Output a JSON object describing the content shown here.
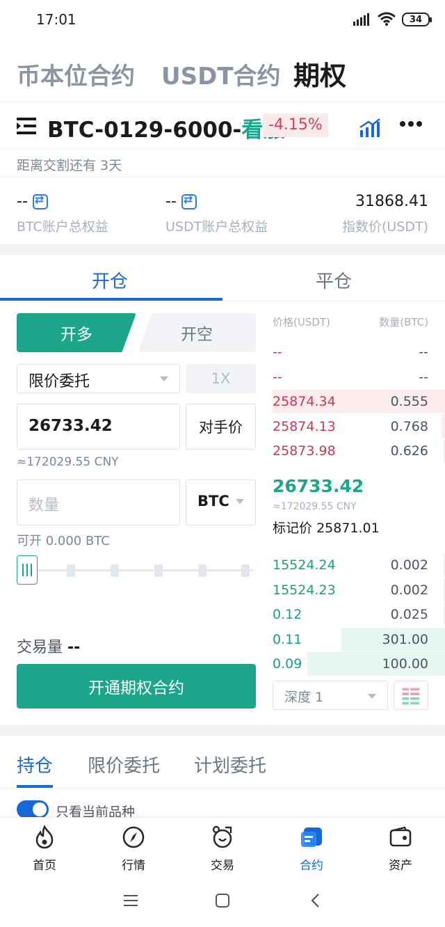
{
  "status_bar": {
    "time": "17:01",
    "battery": "34"
  },
  "top_tabs": [
    {
      "label": "币本位合约",
      "active": false
    },
    {
      "label": "USDT合约",
      "active": false
    },
    {
      "label": "期权",
      "active": true
    }
  ],
  "header": {
    "contract_prefix": "BTC-0129-6000-",
    "contract_direction": "看涨",
    "change_pct": "-4.15%",
    "delivery_text": "距离交割还有 3天"
  },
  "equity": [
    {
      "value": "--",
      "label": "BTC账户总权益",
      "has_transfer": true
    },
    {
      "value": "--",
      "label": "USDT账户总权益",
      "has_transfer": true
    },
    {
      "value": "31868.41",
      "label": "指数价(USDT)",
      "has_transfer": false
    }
  ],
  "trade_tabs": [
    {
      "label": "开仓",
      "active": true
    },
    {
      "label": "平仓",
      "active": false
    }
  ],
  "form": {
    "buy_label": "开多",
    "sell_label": "开空",
    "order_type": "限价委托",
    "leverage": "1X",
    "price_value": "26733.42",
    "counterparty_price": "对手价",
    "price_cny": "≈172029.55 CNY",
    "quantity_placeholder": "数量",
    "quantity_unit": "BTC",
    "available": "可开 0.000 BTC",
    "volume_label": "交易量",
    "volume_value": "--",
    "submit_label": "开通期权合约"
  },
  "order_book": {
    "price_header": "价格(USDT)",
    "qty_header": "数量(BTC)",
    "asks": [
      {
        "price": "--",
        "qty": "--",
        "depth": 0
      },
      {
        "price": "--",
        "qty": "--",
        "depth": 0
      },
      {
        "price": "25874.34",
        "qty": "0.555",
        "depth": 1.0
      },
      {
        "price": "25874.13",
        "qty": "0.768",
        "depth": 0.02
      },
      {
        "price": "25873.98",
        "qty": "0.626",
        "depth": 0.01
      }
    ],
    "last_price": "26733.42",
    "last_price_cny": "≈172029.55 CNY",
    "mark_price_label": "标记价",
    "mark_price": "25871.01",
    "bids": [
      {
        "price": "15524.24",
        "qty": "0.002",
        "depth": 0.01
      },
      {
        "price": "15524.23",
        "qty": "0.002",
        "depth": 0.01
      },
      {
        "price": "0.12",
        "qty": "0.025",
        "depth": 0.01
      },
      {
        "price": "0.11",
        "qty": "301.00",
        "depth": 0.6
      },
      {
        "price": "0.09",
        "qty": "100.00",
        "depth": 0.8
      }
    ],
    "depth_select": "深度 1"
  },
  "position_tabs": [
    {
      "label": "持仓",
      "active": true
    },
    {
      "label": "限价委托",
      "active": false
    },
    {
      "label": "计划委托",
      "active": false
    }
  ],
  "current_only_label": "只看当前品种",
  "bottom_nav": [
    {
      "label": "首页",
      "icon": "flame-icon",
      "active": false
    },
    {
      "label": "行情",
      "icon": "compass-icon",
      "active": false
    },
    {
      "label": "交易",
      "icon": "exchange-icon",
      "active": false
    },
    {
      "label": "合约",
      "icon": "contract-icon",
      "active": true
    },
    {
      "label": "资产",
      "icon": "wallet-icon",
      "active": false
    }
  ],
  "colors": {
    "accent_green": "#1ca58a",
    "accent_blue": "#1768d9",
    "ask_red": "#c73a53"
  }
}
